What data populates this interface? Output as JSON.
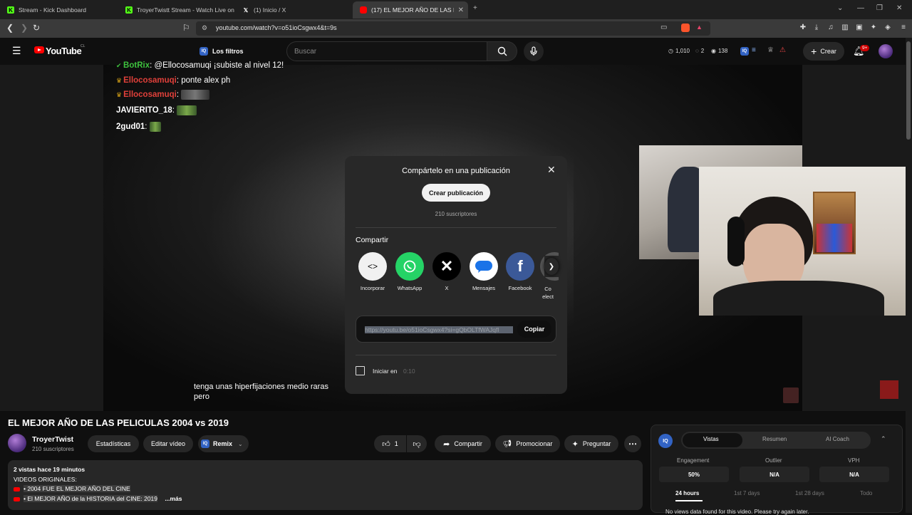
{
  "browser": {
    "tabs": [
      {
        "title": "Stream - Kick Dashboard",
        "icon": "kick-icon"
      },
      {
        "title": "TroyerTwistt Stream - Watch Live on Kick",
        "icon": "kick-icon"
      },
      {
        "title": "(1) Inicio / X",
        "icon": "x-icon"
      },
      {
        "title": "(17) EL MEJOR AÑO DE LAS PELICULAS",
        "icon": "youtube-icon"
      }
    ],
    "url": "youtube.com/watch?v=o51ioCsgwx4&t=9s"
  },
  "header": {
    "logo_text": "YouTube",
    "logo_country": "CL",
    "filters_label": "Los filtros",
    "search_placeholder": "Buscar",
    "stats": {
      "views": "1,010",
      "comments": "2",
      "watch": "138"
    },
    "create_label": "Crear",
    "notif_count": "9+"
  },
  "stream_chat": [
    {
      "user": "BotRix",
      "text": ": @Ellocosamuqi ¡subiste al nivel 12!",
      "color": "#3ec13e",
      "crown": false
    },
    {
      "user": "Ellocosamuqi",
      "text": ": ponte alex ph",
      "color": "#e0403a",
      "crown": true
    },
    {
      "user": "Ellocosamuqi",
      "text": ":",
      "color": "#e0403a",
      "crown": true
    },
    {
      "user": "JAVIERITO_18",
      "text": ":",
      "color": "#ffffff",
      "crown": false
    },
    {
      "user": "2gud01",
      "text": ":",
      "color": "#ffffff",
      "crown": false
    }
  ],
  "caption": [
    "tenga unas hiperfijaciones medio raras",
    "pero"
  ],
  "share_modal": {
    "title": "Compártelo en una publicación",
    "create_post": "Crear publicación",
    "subscribers": "210 suscriptores",
    "share_heading": "Compartir",
    "options": [
      {
        "label": "Incorporar",
        "icon": "embed-icon",
        "color": "#f1f1f1"
      },
      {
        "label": "WhatsApp",
        "icon": "whatsapp-icon",
        "color": "#25d366"
      },
      {
        "label": "X",
        "icon": "x-icon",
        "color": "#000000"
      },
      {
        "label": "Mensajes",
        "icon": "messages-icon",
        "color": "#ffffff"
      },
      {
        "label": "Facebook",
        "icon": "facebook-icon",
        "color": "#3b5998"
      },
      {
        "label": "Co elect",
        "icon": "email-icon",
        "color": "#888888"
      }
    ],
    "share_url": "https://youtu.be/o51ioCsgwx4?si=gQbOLTfWAJqfl",
    "copy_label": "Copiar",
    "start_at_label": "Iniciar en",
    "start_time": "0:10"
  },
  "video": {
    "title": "EL MEJOR AÑO DE LAS PELICULAS 2004 vs 2019",
    "channel": "TroyerTwist",
    "channel_subs": "210 suscriptores",
    "buttons": {
      "stats": "Estadísticas",
      "edit": "Editar vídeo",
      "remix": "Remix",
      "likes": "1",
      "share": "Compartir",
      "promote": "Promocionar",
      "ask": "Preguntar"
    },
    "description": {
      "meta": "2 vistas  hace 19 minutos",
      "line1": "VIDEOS ORIGINALES:",
      "link1": "• 2004 FUE EL MEJOR AÑO DEL CINE",
      "link2": "• El MEJOR AÑO de la HISTORIA del CINE: 2019",
      "more": "...más"
    }
  },
  "analytics_panel": {
    "badge": "IQ",
    "tabs": [
      "Vistas",
      "Resumen",
      "AI Coach"
    ],
    "metrics": [
      {
        "label": "Engagement",
        "value": "50%"
      },
      {
        "label": "Outlier",
        "value": "N/A"
      },
      {
        "label": "VPH",
        "value": "N/A"
      }
    ],
    "ranges": [
      "24 hours",
      "1st 7 days",
      "1st 28 days",
      "Todo"
    ],
    "no_data": "No views data found for this video. Please try again later."
  }
}
